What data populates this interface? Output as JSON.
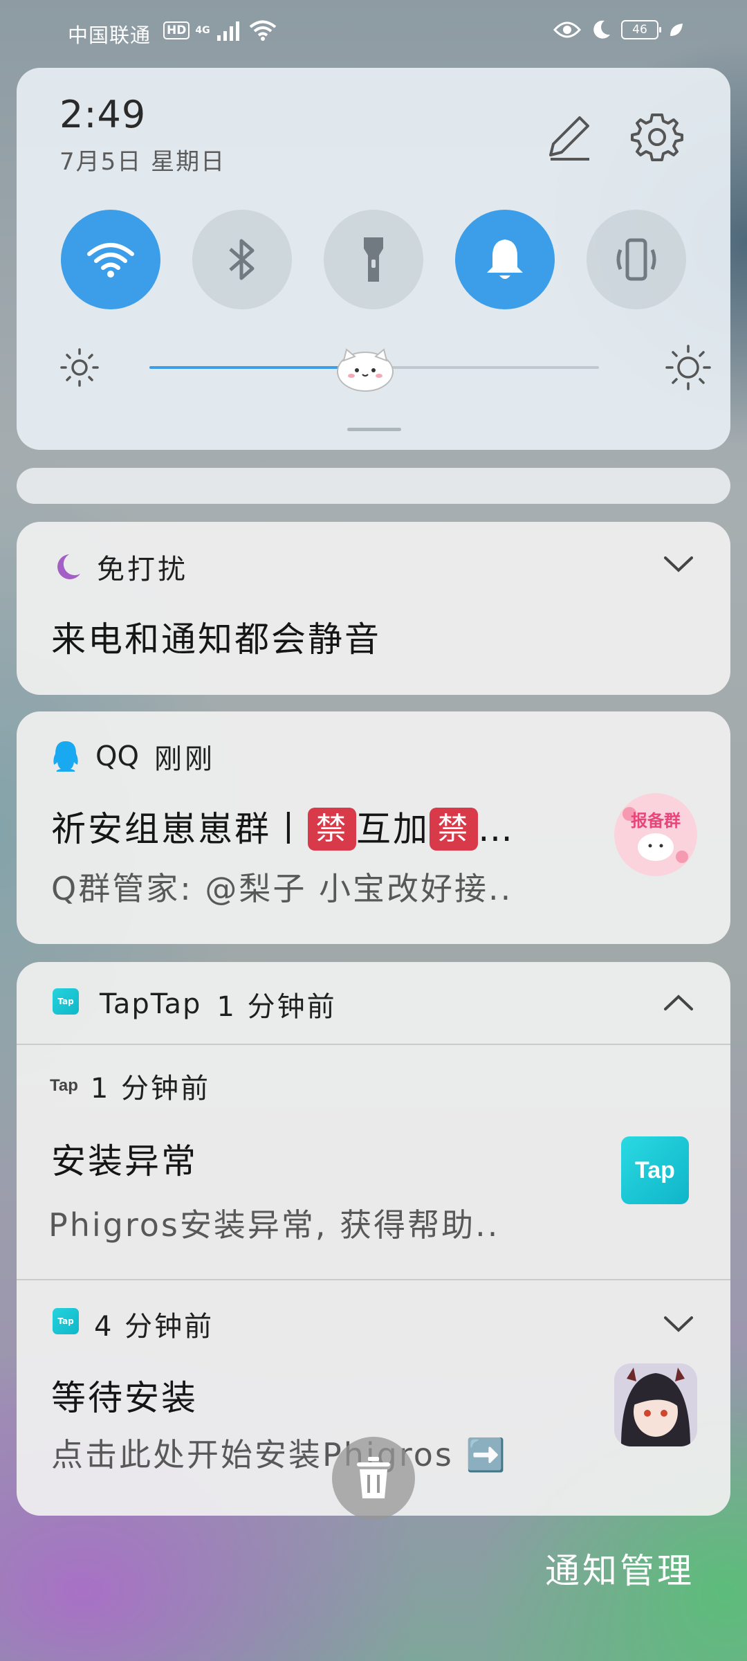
{
  "status_bar": {
    "carrier": "中国联通",
    "hd": "HD",
    "network": "4G",
    "battery": "46"
  },
  "quick_settings": {
    "time": "2:49",
    "date": "7月5日 星期日",
    "brightness_level": 0.48,
    "toggles": [
      {
        "name": "wifi",
        "on": true
      },
      {
        "name": "bluetooth",
        "on": false
      },
      {
        "name": "flashlight",
        "on": false
      },
      {
        "name": "ring",
        "on": true
      },
      {
        "name": "vibrate",
        "on": false
      }
    ],
    "accent_color": "#3c9ee8"
  },
  "dnd": {
    "title": "免打扰",
    "message": "来电和通知都会静音"
  },
  "qq": {
    "app": "QQ",
    "time": "刚刚",
    "title_prefix": "祈安组崽崽群丨",
    "ban": "禁",
    "title_mid": "互加",
    "ellipsis": "…",
    "message": "Q群管家: @梨子 小宝改好接..",
    "avatar_text": "报备群"
  },
  "taptap": {
    "app": "TapTap",
    "time": "1 分钟前",
    "icon_text": "Tap",
    "items": [
      {
        "time": "1 分钟前",
        "title": "安装异常",
        "message": "Phigros安装异常, 获得帮助.."
      },
      {
        "time": "4 分钟前",
        "title": "等待安装",
        "message": "点击此处开始安装Phigros ➡️"
      }
    ]
  },
  "footer": {
    "manage": "通知管理"
  }
}
